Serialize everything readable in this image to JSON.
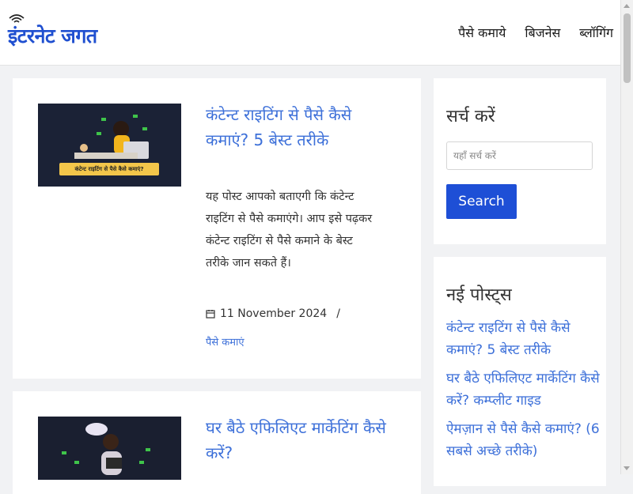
{
  "header": {
    "logo_text": "इंटरनेट जगत",
    "nav": [
      {
        "label": "पैसे कमाये"
      },
      {
        "label": "बिजनेस"
      },
      {
        "label": "ब्लॉगिंग"
      }
    ]
  },
  "posts": [
    {
      "title": "कंटेन्ट राइटिंग से पैसे कैसे कमाएं? 5 बेस्ट तरीके",
      "thumb_caption": "कंटेन्ट राइटिंग से पैसे कैसे कमाएं?",
      "excerpt": "यह पोस्ट आपको बताएगी कि कंटेन्ट राइटिंग से पैसे कमाएंगे। आप इसे पढ़कर कंटेन्ट राइटिंग से पैसे कमाने के बेस्ट तरीके जान सकते हैं।",
      "date": "11 November 2024",
      "separator": "/",
      "category": "पैसे कमाएं"
    },
    {
      "title": "घर बैठे एफिलिएट मार्केटिंग कैसे करें?"
    }
  ],
  "sidebar": {
    "search_title": "सर्च करें",
    "search_placeholder": "यहाँ सर्च करें",
    "search_button": "Search",
    "recent_title": "नई पोस्ट्स",
    "recent_posts": [
      {
        "label": "कंटेन्ट राइटिंग से पैसे कैसे कमाएं? 5 बेस्ट तरीके"
      },
      {
        "label": "घर बैठे एफिलिएट मार्केटिंग कैसे करें? कम्प्लीट गाइड"
      },
      {
        "label": "ऐमज़ान से पैसे कैसे कमाएं? (6 सबसे अच्छे तरीके)"
      }
    ]
  },
  "colors": {
    "accent": "#3d70d9",
    "logo": "#1f4fd0",
    "button": "#1e4fd6",
    "background": "#f1f2f4"
  }
}
